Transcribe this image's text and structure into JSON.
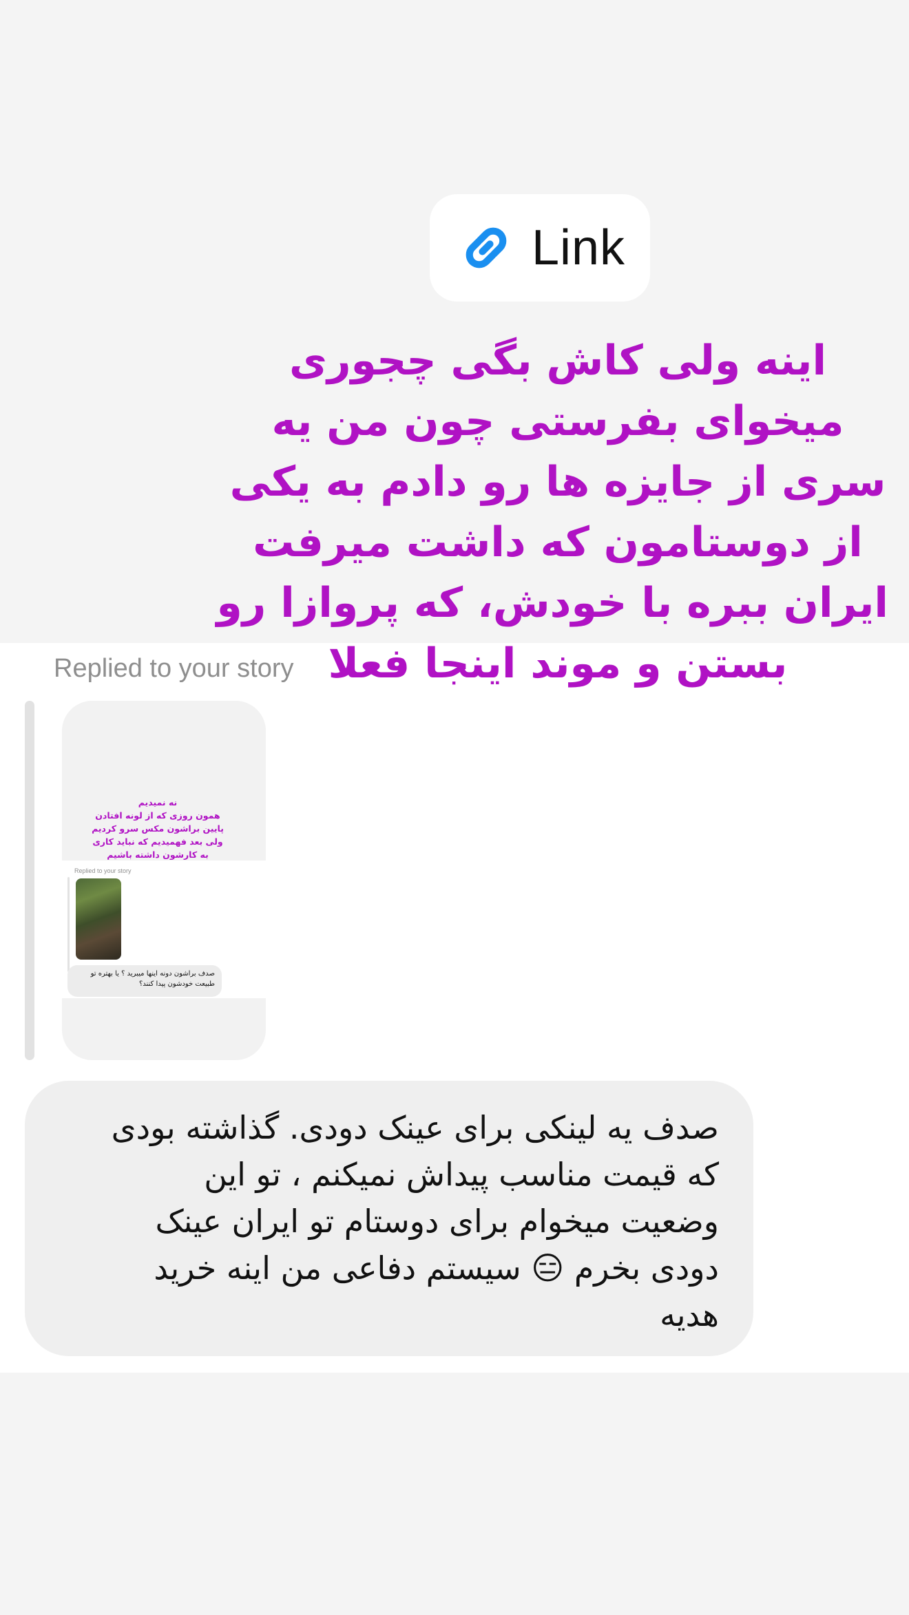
{
  "story": {
    "link_sticker_label": "Link",
    "overlay_lines": [
      "اینه ولی کاش بگی چجوری",
      "میخوای بفرستی چون من یه",
      "سری از جایزه ها رو دادم به یکی",
      "از دوستامون که داشت میرفت",
      "ایران ببره با خودش، که پروازا رو",
      "بستن و موند اینجا فعلا"
    ],
    "overlay_color": "#b012c4",
    "link_icon_color": "#1a8ff0"
  },
  "reply": {
    "label": "Replied to your story",
    "thumbnail": {
      "lines": [
        "نه نمیدیم",
        "همون روزی که از لونه افتادن",
        "پایین براشون مکس سرو کردیم",
        "ولی بعد فهمیدیم که نباید کاری",
        "به کارشون داشته باشیم"
      ],
      "inner_label": "Replied to your story",
      "inner_message": "صدف براشون دونه اینها میبرید ؟ یا بهتره تو طبیعت خودشون پیدا کنند؟"
    }
  },
  "message": {
    "lines": [
      "صدف یه لینکی برای عینک دودی. گذاشته بودی",
      "که قیمت مناسب پیداش نمیکنم ، تو این",
      "وضعیت میخوام برای دوستام تو ایران عینک",
      "دودی بخرم 😑 سیستم دفاعی من اینه خرید",
      "هدیه"
    ]
  }
}
